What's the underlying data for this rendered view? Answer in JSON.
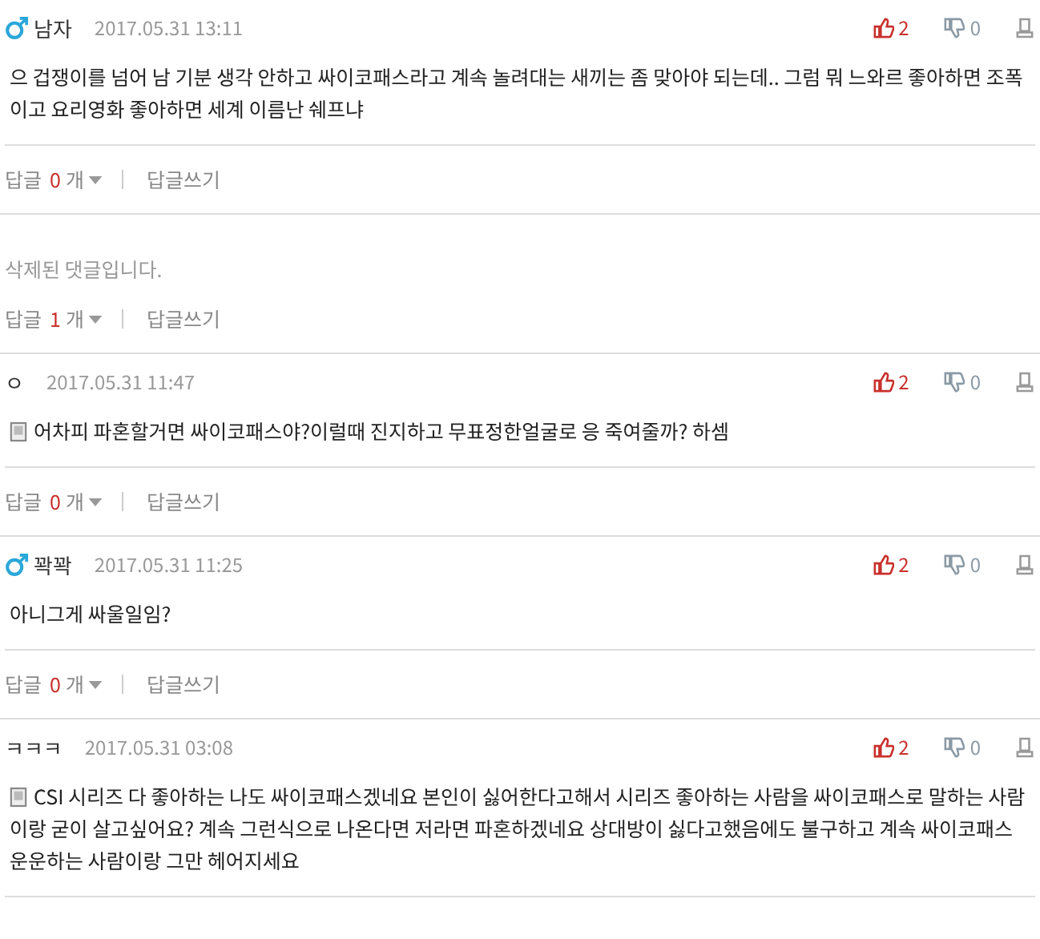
{
  "comments": [
    {
      "kind": "comment",
      "author": "남자",
      "male": true,
      "date": "2017.05.31 13:11",
      "likes": "2",
      "dislikes": "0",
      "mobile": false,
      "text": "으 겁쟁이를 넘어 남 기분 생각 안하고 싸이코패스라고 계속 놀려대는 새끼는 좀 맞아야 되는데.. 그럼 뭐 느와르 좋아하면 조폭이고 요리영화 좋아하면 세계 이름난 쉐프냐",
      "reply_label": "답글",
      "reply_count": "0",
      "reply_unit": "개",
      "write_label": "답글쓰기"
    },
    {
      "kind": "deleted",
      "text": "삭제된 댓글입니다.",
      "reply_label": "답글",
      "reply_count": "1",
      "reply_unit": "개",
      "write_label": "답글쓰기"
    },
    {
      "kind": "comment",
      "author": "ㅇ",
      "male": false,
      "date": "2017.05.31 11:47",
      "likes": "2",
      "dislikes": "0",
      "mobile": true,
      "text": "어차피 파혼할거면 싸이코패스야?이럴때 진지하고 무표정한얼굴로 응 죽여줄까? 하셈",
      "reply_label": "답글",
      "reply_count": "0",
      "reply_unit": "개",
      "write_label": "답글쓰기"
    },
    {
      "kind": "comment",
      "author": "꽉꽉",
      "male": true,
      "date": "2017.05.31 11:25",
      "likes": "2",
      "dislikes": "0",
      "mobile": false,
      "text": "아니그게 싸울일임?",
      "reply_label": "답글",
      "reply_count": "0",
      "reply_unit": "개",
      "write_label": "답글쓰기"
    },
    {
      "kind": "comment",
      "author": "ㅋㅋㅋ",
      "male": false,
      "date": "2017.05.31 03:08",
      "likes": "2",
      "dislikes": "0",
      "mobile": true,
      "text": "CSI 시리즈 다 좋아하는 나도 싸이코패스겠네요 본인이 싫어한다고해서 시리즈 좋아하는 사람을 싸이코패스로 말하는 사람이랑 굳이 살고싶어요? 계속 그런식으로 나온다면 저라면 파혼하겠네요 상대방이 싫다고했음에도 불구하고 계속 싸이코패스 운운하는 사람이랑 그만 헤어지세요"
    }
  ]
}
